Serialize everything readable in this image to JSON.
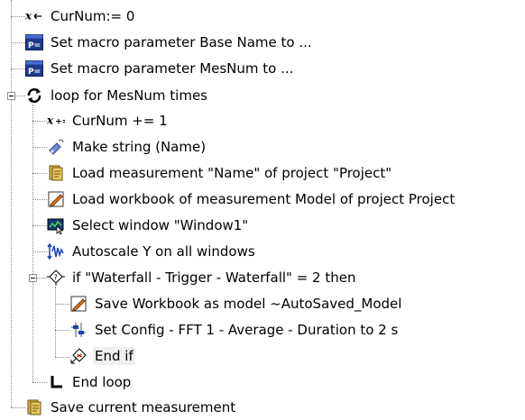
{
  "tree": {
    "nodes": [
      {
        "label": "CurNum:= 0",
        "icon": "variable-assign-icon"
      },
      {
        "label": "Set macro parameter Base Name to ...",
        "icon": "macro-parameter-icon"
      },
      {
        "label": "Set macro parameter MesNum to ...",
        "icon": "macro-parameter-icon"
      },
      {
        "label": "loop for MesNum times",
        "icon": "loop-icon",
        "expanded": true
      },
      {
        "label": "CurNum += 1",
        "icon": "variable-increment-icon"
      },
      {
        "label": "Make string (Name)",
        "icon": "make-string-icon"
      },
      {
        "label": "Load measurement \"Name\" of project \"Project\"",
        "icon": "load-measurement-icon"
      },
      {
        "label": "Load workbook of measurement Model of project Project",
        "icon": "load-workbook-icon"
      },
      {
        "label": "Select window \"Window1\"",
        "icon": "select-window-icon"
      },
      {
        "label": "Autoscale Y on all windows",
        "icon": "autoscale-icon"
      },
      {
        "label": "if \"Waterfall - Trigger - Waterfall\" = 2 then",
        "icon": "if-condition-icon",
        "expanded": true
      },
      {
        "label": "Save Workbook as model ~AutoSaved_Model",
        "icon": "save-workbook-icon"
      },
      {
        "label": "Set Config - FFT 1 - Average - Duration to 2 s",
        "icon": "set-config-icon"
      },
      {
        "label": "End if",
        "icon": "end-if-icon",
        "selected": true
      },
      {
        "label": "End loop",
        "icon": "end-loop-icon"
      },
      {
        "label": "Save current measurement",
        "icon": "save-measurement-icon"
      }
    ]
  },
  "colors": {
    "text": "#000000",
    "background": "#ffffff",
    "tree_lines": "#8a8a8a",
    "selection": "#f0f0f0",
    "icon_blue": "#1f3a8a",
    "icon_orange": "#e07a1f"
  }
}
